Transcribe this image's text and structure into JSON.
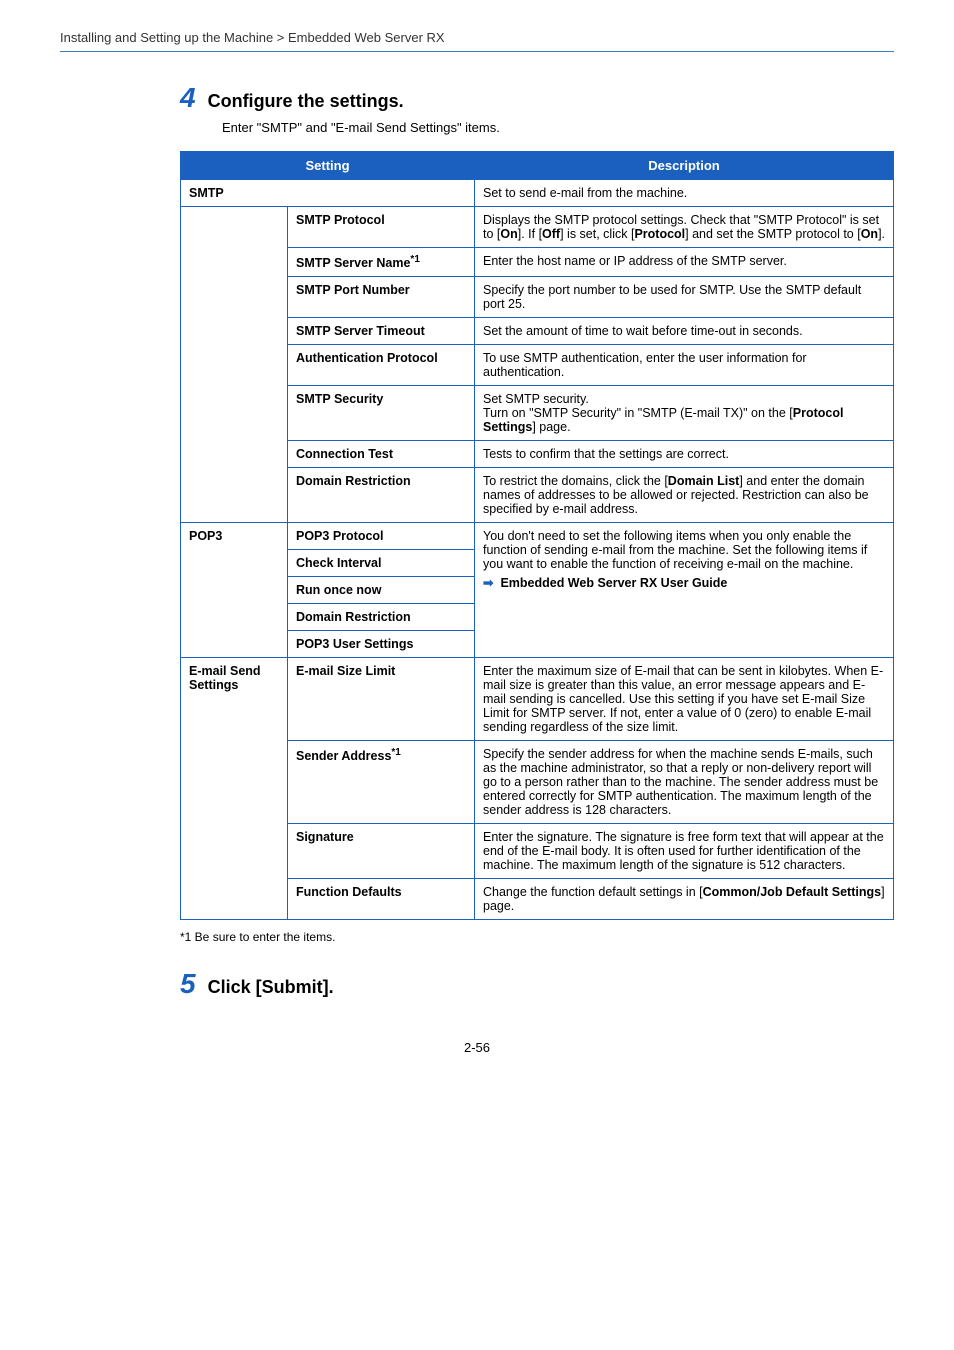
{
  "breadcrumb": "Installing and Setting up the Machine > Embedded Web Server RX",
  "step4": {
    "num": "4",
    "title": "Configure the settings.",
    "sub": "Enter \"SMTP\" and \"E-mail Send Settings\" items."
  },
  "table": {
    "headers": {
      "setting": "Setting",
      "description": "Description"
    },
    "smtp": {
      "cat": "SMTP",
      "catdesc": "Set to send e-mail from the machine.",
      "rows": [
        {
          "name": "SMTP Protocol",
          "desc": "Displays the SMTP protocol settings. Check that \"SMTP Protocol\" is set to [<b>On</b>]. If [<b>Off</b>] is set, click [<b>Protocol</b>] and set the SMTP protocol to [<b>On</b>]."
        },
        {
          "name": "SMTP Server Name",
          "sup": "*1",
          "desc": "Enter the host name or IP address of the SMTP server."
        },
        {
          "name": "SMTP Port Number",
          "desc": "Specify the port number to be used for SMTP. Use the SMTP default port 25."
        },
        {
          "name": "SMTP Server Timeout",
          "desc": "Set the amount of time to wait before time-out in seconds."
        },
        {
          "name": "Authentication Protocol",
          "desc": "To use SMTP authentication, enter the user information for authentication."
        },
        {
          "name": "SMTP Security",
          "desc": "Set SMTP security.<br>Turn on \"SMTP Security\" in \"SMTP (E-mail TX)\" on the [<b>Protocol Settings</b>] page."
        },
        {
          "name": "Connection Test",
          "desc": "Tests to confirm that the settings are correct."
        },
        {
          "name": "Domain Restriction",
          "desc": "To restrict the domains, click the [<b>Domain List</b>] and enter the domain names of addresses to be allowed or rejected. Restriction can also be specified by e-mail address."
        }
      ]
    },
    "pop3": {
      "cat": "POP3",
      "rows": [
        {
          "name": "POP3 Protocol"
        },
        {
          "name": "Check Interval"
        },
        {
          "name": "Run once now"
        },
        {
          "name": "Domain Restriction"
        },
        {
          "name": "POP3 User Settings"
        }
      ],
      "desc_lines": [
        "You don't need to set the following items when you only enable the function of sending e-mail from the machine. Set the following items if you want to enable the function of receiving e-mail on the machine."
      ],
      "link": "Embedded Web Server RX User Guide"
    },
    "email": {
      "cat": "E-mail Send Settings",
      "rows": [
        {
          "name": "E-mail Size Limit",
          "desc": "Enter the maximum size of E-mail that can be sent in kilobytes. When E-mail size is greater than this value, an error message appears and E-mail sending is cancelled. Use this setting if you have set E-mail Size Limit for SMTP server. If not, enter a value of 0 (zero) to enable E-mail sending regardless of the size limit."
        },
        {
          "name": "Sender Address",
          "sup": "*1",
          "desc": "Specify the sender address for when the machine sends E-mails, such as the machine administrator, so that a reply or non-delivery report will go to a person rather than to the machine. The sender address must be entered correctly for SMTP authentication. The maximum length of the sender address is 128 characters."
        },
        {
          "name": "Signature",
          "desc": "Enter the signature. The signature is free form text that will appear at the end of the E-mail body. It is often used for further identification of the machine. The maximum length of the signature is 512 characters."
        },
        {
          "name": "Function Defaults",
          "desc": "Change the function default settings in [<b>Common/Job Default Settings</b>] page."
        }
      ]
    }
  },
  "footnote": "*1   Be sure to enter the items.",
  "step5": {
    "num": "5",
    "title": "Click [Submit]."
  },
  "pagenum": "2-56"
}
